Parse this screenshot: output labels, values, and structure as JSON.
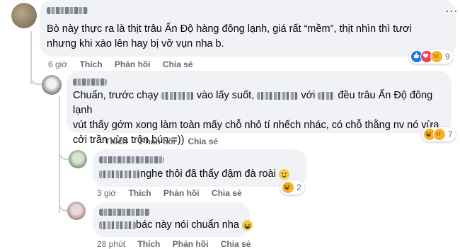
{
  "comment1": {
    "text_line1": "Bò này thực ra là thịt trâu Ấn Độ hàng đông lạnh, giá rất “mềm”, thịt nhìn thì tươi",
    "text_line2": "nhưng khi xào lên hay bị vỡ vụn nha b.",
    "time": "6 giờ",
    "like": "Thích",
    "reply": "Phản hồi",
    "share": "Chia sẻ",
    "reaction_count": "9",
    "reaction_icons": [
      "like-icon",
      "love-icon",
      "sad-icon"
    ]
  },
  "comment2": {
    "text_line1_a": "Chuẩn, trước chạy",
    "text_line1_b": "vào lấy suốt,",
    "text_line1_c": "với",
    "text_line1_d": "đều trâu Ấn Độ đông lạnh",
    "text_line2": "vút thấy gớm xong làm toàn mấy chỗ nhỏ tí nhếch nhác, có chỗ thằng nv nó vừa",
    "text_line3": "cởi trần vừa trộn bún =))",
    "reaction_count": "7",
    "reaction_icons": [
      "haha-icon",
      "sad-icon"
    ]
  },
  "comment3": {
    "text": "nghe thôi đã thấy đậm đà roài",
    "time": "3 giờ",
    "like": "Thích",
    "reply": "Phản hồi",
    "share": "Chia sẻ",
    "reaction_count": "2",
    "reaction_icons": [
      "haha-icon"
    ]
  },
  "comment4": {
    "text": "bác này nói chuẩn nha",
    "time": "28 phút",
    "like": "Thích",
    "reply": "Phản hồi",
    "share": "Chia sẻ"
  },
  "comment2_actions": {
    "like": "Thích",
    "reply": "Phản hồi",
    "share": "Chia sẻ"
  }
}
